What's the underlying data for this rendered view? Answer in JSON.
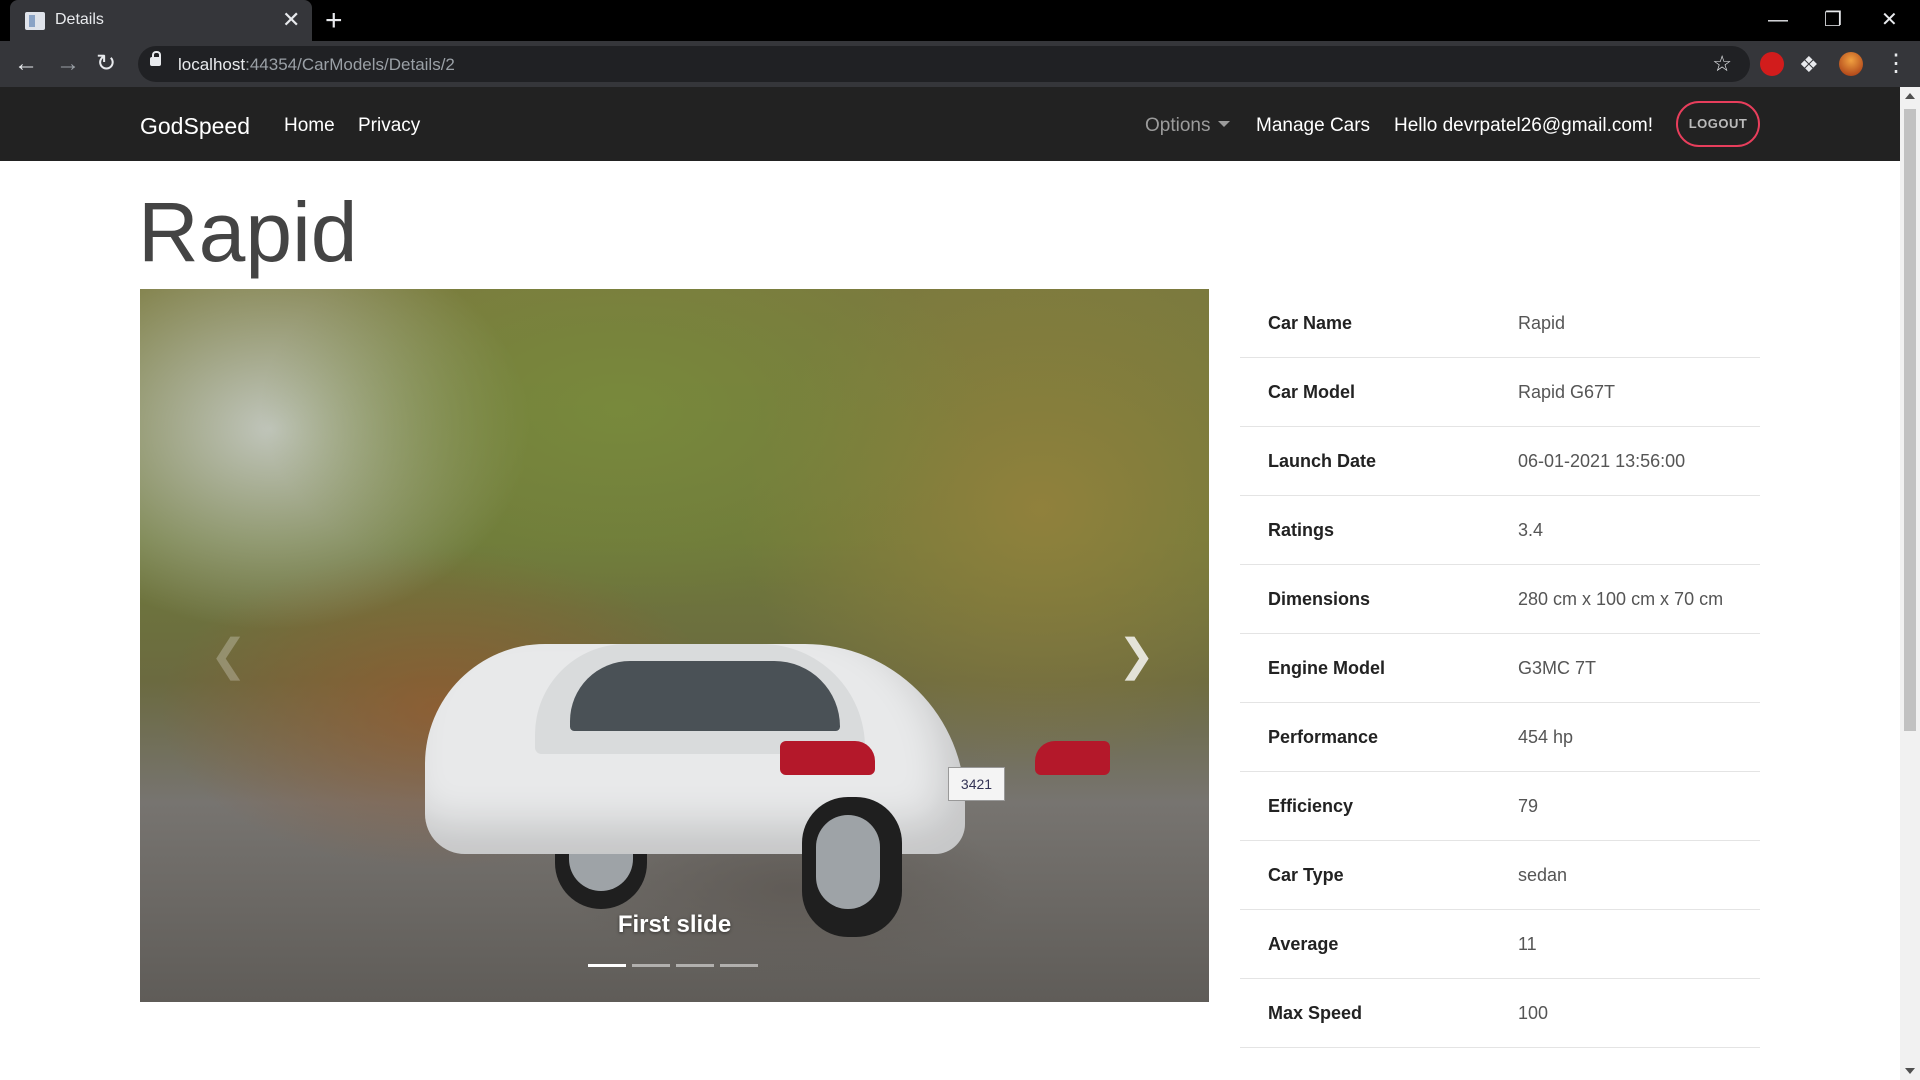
{
  "browser": {
    "tab_title": "Details",
    "tab_close": "✕",
    "new_tab": "+",
    "url_host": "localhost",
    "url_path": ":44354/CarModels/Details/2",
    "window_controls": {
      "minimize": "—",
      "restore": "❐",
      "close": "✕"
    }
  },
  "navbar": {
    "brand": "GodSpeed",
    "links": [
      "Home",
      "Privacy"
    ],
    "options": "Options",
    "manage": "Manage Cars",
    "greeting": "Hello devrpatel26@gmail.com!",
    "logout": "LOGOUT"
  },
  "page": {
    "title": "Rapid",
    "carousel": {
      "caption": "First slide",
      "plate_text": "3421",
      "slide_count": 4,
      "active_index": 0
    },
    "details": [
      {
        "label": "Car Name",
        "value": "Rapid"
      },
      {
        "label": "Car Model",
        "value": "Rapid G67T"
      },
      {
        "label": "Launch Date",
        "value": "06-01-2021 13:56:00"
      },
      {
        "label": "Ratings",
        "value": "3.4"
      },
      {
        "label": "Dimensions",
        "value": "280 cm x 100 cm x 70 cm"
      },
      {
        "label": "Engine Model",
        "value": "G3MC 7T"
      },
      {
        "label": "Performance",
        "value": "454 hp"
      },
      {
        "label": "Efficiency",
        "value": "79"
      },
      {
        "label": "Car Type",
        "value": "sedan"
      },
      {
        "label": "Average",
        "value": "11"
      },
      {
        "label": "Max Speed",
        "value": "100"
      }
    ]
  },
  "colors": {
    "navbar_bg": "#222222",
    "logout_border": "#e83e5c",
    "title_text": "#444444"
  },
  "icons": {
    "back": "arrow-left-icon",
    "forward": "arrow-right-icon",
    "reload": "reload-icon",
    "lock": "lock-icon",
    "bookmark": "star-icon",
    "extensions": "puzzle-icon",
    "menu": "kebab-menu-icon"
  }
}
